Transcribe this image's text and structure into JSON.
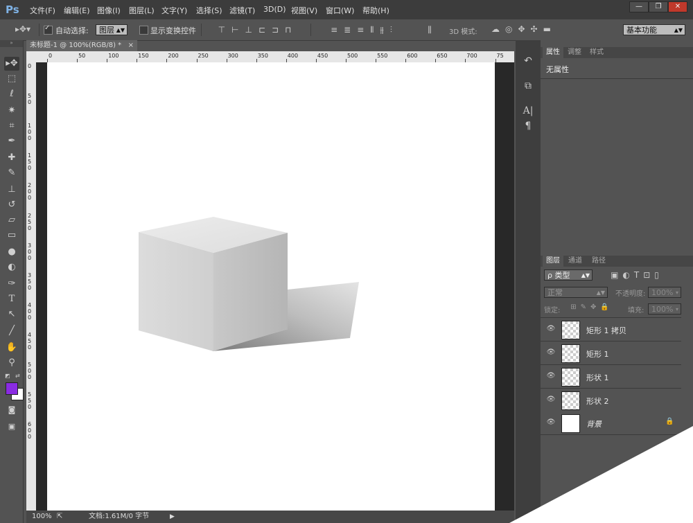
{
  "app": {
    "logo": "Ps"
  },
  "menu": [
    "文件(F)",
    "编辑(E)",
    "图像(I)",
    "图层(L)",
    "文字(Y)",
    "选择(S)",
    "滤镜(T)",
    "3D(D)",
    "视图(V)",
    "窗口(W)",
    "帮助(H)"
  ],
  "window_buttons": {
    "minimize": "—",
    "restore": "❐",
    "close": "✕"
  },
  "options": {
    "auto_select_label": "自动选择:",
    "auto_select_checked": true,
    "auto_select_target": "图层",
    "show_transform_label": "显示变换控件",
    "show_transform_checked": false,
    "mode_3d_label": "3D 模式:",
    "workspace": "基本功能"
  },
  "document": {
    "tab_title": "未标题-1 @ 100%(RGB/8) *",
    "tab_close": "×",
    "ruler_top": [
      "0",
      "50",
      "100",
      "150",
      "200",
      "250",
      "300",
      "350",
      "400",
      "450",
      "500",
      "550",
      "600",
      "650",
      "700",
      "75"
    ],
    "ruler_left": [
      "0",
      "5 0",
      "1 0 0",
      "1 5 0",
      "2 0 0",
      "2 5 0",
      "3 0 0",
      "3 5 0",
      "4 0 0",
      "4 5 0",
      "5 0 0",
      "5 5 0",
      "6 0 0"
    ]
  },
  "status": {
    "zoom": "100%",
    "doc_info": "文档:1.61M/0 字节"
  },
  "properties_panel": {
    "tabs": [
      "属性",
      "调整",
      "样式"
    ],
    "active_tab": "属性",
    "content": "无属性"
  },
  "layers_panel": {
    "tabs": [
      "图层",
      "通道",
      "路径"
    ],
    "active_tab": "图层",
    "filter_kind": "ρ 类型",
    "blend_mode": "正常",
    "opacity_label": "不透明度:",
    "opacity_value": "100%",
    "lock_label": "锁定:",
    "fill_label": "填充:",
    "fill_value": "100%",
    "layers": [
      {
        "name": "矩形 1 拷贝",
        "visible": true
      },
      {
        "name": "矩形 1",
        "visible": true
      },
      {
        "name": "形状 1",
        "visible": true
      },
      {
        "name": "形状 2",
        "visible": true
      },
      {
        "name": "背景",
        "visible": true,
        "locked": true
      }
    ]
  },
  "colors": {
    "foreground": "#8a2be2",
    "background": "#ffffff"
  },
  "tools": [
    "move-tool",
    "marquee-tool",
    "lasso-tool",
    "magic-wand-tool",
    "crop-tool",
    "eyedropper-tool",
    "spot-healing-tool",
    "brush-tool",
    "clone-stamp-tool",
    "history-brush-tool",
    "eraser-tool",
    "gradient-tool",
    "blur-tool",
    "dodge-tool",
    "pen-tool",
    "type-tool",
    "path-selection-tool",
    "line-tool",
    "hand-tool",
    "zoom-tool"
  ]
}
